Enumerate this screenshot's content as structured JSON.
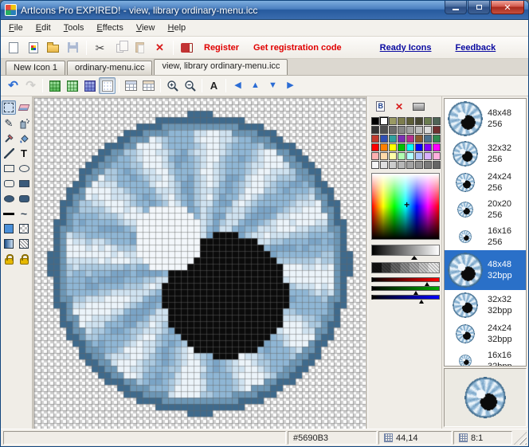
{
  "window": {
    "title": "ArtIcons Pro EXPIRED! - view, library ordinary-menu.icc"
  },
  "menu": {
    "items": [
      {
        "label": "File"
      },
      {
        "label": "Edit"
      },
      {
        "label": "Tools"
      },
      {
        "label": "Effects"
      },
      {
        "label": "View"
      },
      {
        "label": "Help"
      }
    ]
  },
  "toolbar": {
    "links": [
      {
        "label": "Register",
        "style": "red"
      },
      {
        "label": "Get registration code",
        "style": "red"
      },
      {
        "label": "Ready Icons",
        "style": "blue"
      },
      {
        "label": "Feedback",
        "style": "blue"
      }
    ]
  },
  "tabs": [
    {
      "label": "New Icon 1",
      "active": false
    },
    {
      "label": "ordinary-menu.icc",
      "active": false
    },
    {
      "label": "view, library ordinary-menu.icc",
      "active": true
    }
  ],
  "edit_toolbar": {
    "buttons": [
      {
        "name": "undo-button",
        "glyph": "undo"
      },
      {
        "name": "redo-button",
        "glyph": "redo",
        "disabled": true
      },
      {
        "sep": true
      },
      {
        "name": "pen-grid-button",
        "glyph": "grid-green1"
      },
      {
        "name": "fill-grid-button",
        "glyph": "grid-green2"
      },
      {
        "name": "palette-grid-button",
        "glyph": "grid-blue"
      },
      {
        "name": "show-grid-button",
        "glyph": "grid-dots",
        "pressed": true
      },
      {
        "sep": true
      },
      {
        "name": "test-icon-button",
        "glyph": "table1"
      },
      {
        "name": "icon-list-button",
        "glyph": "table2"
      },
      {
        "sep": true
      },
      {
        "name": "zoom-in-button",
        "glyph": "zoom-in"
      },
      {
        "name": "zoom-out-button",
        "glyph": "zoom-out"
      },
      {
        "sep": true
      },
      {
        "name": "hotspot-button",
        "glyph": "hotspot"
      },
      {
        "sep": true
      },
      {
        "name": "shift-left-button",
        "glyph": "left"
      },
      {
        "name": "shift-up-button",
        "glyph": "up"
      },
      {
        "name": "shift-down-button",
        "glyph": "down"
      },
      {
        "name": "shift-right-button",
        "glyph": "right"
      }
    ]
  },
  "tools": [
    {
      "name": "select-tool",
      "glyph": "select",
      "active": true
    },
    {
      "name": "eraser-tool",
      "glyph": "eraser"
    },
    {
      "name": "pencil-tool",
      "glyph": "pencil"
    },
    {
      "name": "airbrush-tool",
      "glyph": "spray"
    },
    {
      "name": "color-picker-tool",
      "glyph": "dropper"
    },
    {
      "name": "fill-tool",
      "glyph": "bucket"
    },
    {
      "name": "line-tool",
      "glyph": "line"
    },
    {
      "name": "text-tool",
      "glyph": "text"
    },
    {
      "name": "rectangle-tool",
      "glyph": "rect"
    },
    {
      "name": "ellipse-tool",
      "glyph": "ellipse"
    },
    {
      "name": "rounded-rect-tool",
      "glyph": "rrect"
    },
    {
      "name": "filled-rectangle-tool",
      "glyph": "frect"
    },
    {
      "name": "filled-ellipse-tool",
      "glyph": "fellipse"
    },
    {
      "name": "filled-rounded-rect-tool",
      "glyph": "frrect"
    },
    {
      "name": "line-width-selector",
      "glyph": "linew"
    },
    {
      "name": "curve-tool",
      "glyph": "curve"
    },
    {
      "name": "foreground-color-swatch",
      "glyph": "fg"
    },
    {
      "name": "background-color-swatch",
      "glyph": "bgc"
    },
    {
      "name": "gradient-tool",
      "glyph": "gradient"
    },
    {
      "name": "dither-tool",
      "glyph": "pattern"
    },
    {
      "name": "lock-colors-button",
      "glyph": "lock"
    },
    {
      "name": "lock-transparency-button",
      "glyph": "lock"
    }
  ],
  "palette": {
    "selected_index": 1,
    "colors": [
      "#000000",
      "#ffffff",
      "#9a9a64",
      "#7d7d4e",
      "#5e5e38",
      "#474732",
      "#6b7d50",
      "#4e6456",
      "#343434",
      "#4f4f4f",
      "#6b6b6b",
      "#878787",
      "#a3a3a3",
      "#bfbfbf",
      "#dbdbdb",
      "#702f2f",
      "#c23a2e",
      "#2f4fb4",
      "#2f9e9e",
      "#7a2fb4",
      "#b42f8e",
      "#8a5a2f",
      "#4a708e",
      "#2f8a4f",
      "#ff0000",
      "#ff8000",
      "#ffff00",
      "#00c000",
      "#00ffff",
      "#0000ff",
      "#8000ff",
      "#ff00ff",
      "#ffb0b0",
      "#ffd9a8",
      "#ffffa8",
      "#b0ffb0",
      "#b0ffff",
      "#b0c4ff",
      "#d9b0ff",
      "#ffb0dd",
      "#f5f5f5",
      "#e0e0e0",
      "#cccccc",
      "#b8b8b8",
      "#a3a3a3",
      "#8f8f8f",
      "#7a7a7a",
      "#666666"
    ]
  },
  "formats": {
    "items": [
      {
        "size": "48x48",
        "depth": "256",
        "selected": false
      },
      {
        "size": "32x32",
        "depth": "256",
        "selected": false
      },
      {
        "size": "24x24",
        "depth": "256",
        "selected": false
      },
      {
        "size": "20x20",
        "depth": "256",
        "selected": false
      },
      {
        "size": "16x16",
        "depth": "256",
        "selected": false
      },
      {
        "size": "48x48",
        "depth": "32bpp",
        "selected": true
      },
      {
        "size": "32x32",
        "depth": "32bpp",
        "selected": false
      },
      {
        "size": "24x24",
        "depth": "32bpp",
        "selected": false
      },
      {
        "size": "16x16",
        "depth": "32bpp",
        "selected": false
      }
    ]
  },
  "statusbar": {
    "color_hex": "#5690B3",
    "cursor_position": "44,14",
    "zoom": "8:1"
  },
  "eye_art": {
    "grid": 48,
    "bg_checker": [
      "#ffffff",
      "#cfcfcf"
    ],
    "ring_outer": "#3f6a8c",
    "ring_inner": "#6c96b5",
    "iris_ramp": [
      "#7aa4c6",
      "#8fb6d5",
      "#abc9e0",
      "#cfe2f0",
      "#ecf4fa"
    ],
    "pupil": "#0b0b0b",
    "highlight": "#f3f7fb",
    "pupil_center": [
      27.5,
      28.5
    ],
    "pupil_radius": 9.7,
    "highlight_center": [
      18.5,
      19.5
    ],
    "highlight_radius": 5.3,
    "spokes": 12
  }
}
